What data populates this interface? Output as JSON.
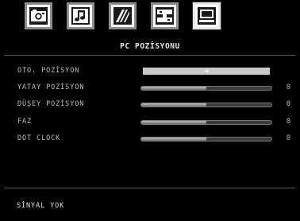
{
  "icons": [
    {
      "name": "picture-icon",
      "active": false
    },
    {
      "name": "sound-icon",
      "active": false
    },
    {
      "name": "settings-icon",
      "active": false
    },
    {
      "name": "source-icon",
      "active": false
    },
    {
      "name": "pc-position-icon",
      "active": true
    }
  ],
  "menu": {
    "title": "PC POZİSYONU",
    "rows": [
      {
        "label": "OTO. POZİSYON",
        "type": "action",
        "arrow": "➜"
      },
      {
        "label": "YATAY POZİSYON",
        "type": "slider",
        "value": "0",
        "level": 0.5
      },
      {
        "label": "DÜŞEY POZİSYON",
        "type": "slider",
        "value": "0",
        "level": 0.5
      },
      {
        "label": "FAZ",
        "type": "slider",
        "value": "0",
        "level": 0.5
      },
      {
        "label": "DOT CLOCK",
        "type": "slider",
        "value": "0",
        "level": 0.5
      }
    ]
  },
  "status": {
    "text": "SİNYAL YOK"
  },
  "colors": {
    "background": "#000000",
    "text": "#bdbdbd",
    "highlight": "#c9c9c9"
  }
}
